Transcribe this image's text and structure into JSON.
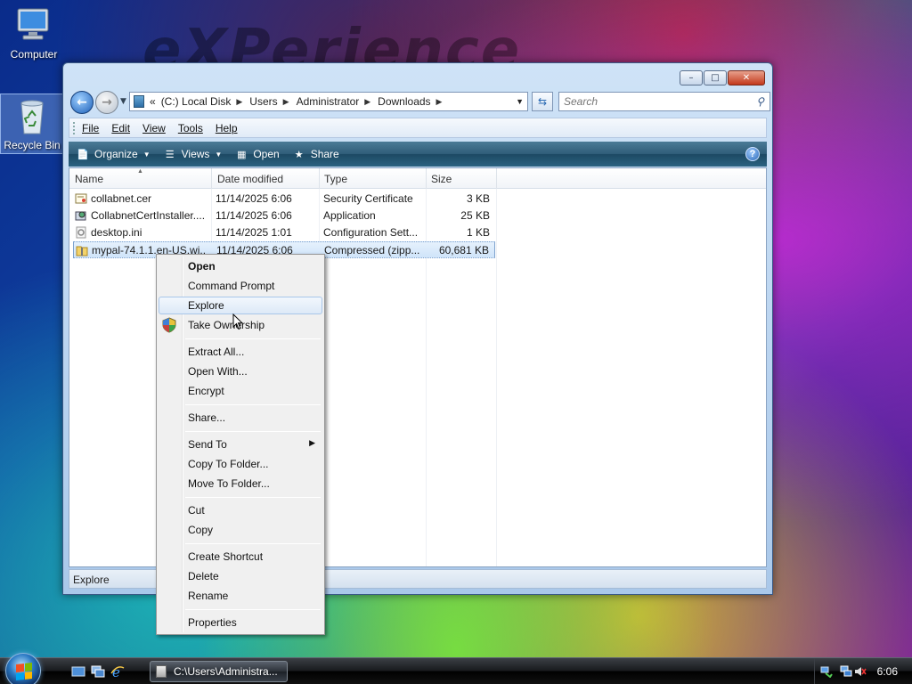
{
  "desktop": {
    "watermark": "eXPerience",
    "icons": [
      {
        "label": "Computer",
        "icon": "computer-icon"
      },
      {
        "label": "Recycle Bin",
        "icon": "recycle-bin-icon"
      }
    ]
  },
  "window": {
    "controls": {
      "minimize": "–",
      "maximize": "□",
      "close": "✕"
    },
    "address": {
      "prefix": "«",
      "crumbs": [
        "(C:) Local Disk",
        "Users",
        "Administrator",
        "Downloads"
      ],
      "separator": "▶"
    },
    "search_placeholder": "Search",
    "menu": [
      "File",
      "Edit",
      "View",
      "Tools",
      "Help"
    ],
    "toolbar": {
      "organize": "Organize",
      "views": "Views",
      "open": "Open",
      "share": "Share",
      "help": "?"
    },
    "columns": [
      "Name",
      "Date modified",
      "Type",
      "Size"
    ],
    "files": [
      {
        "name": "collabnet.cer",
        "date": "11/14/2025 6:06",
        "type": "Security Certificate",
        "size": "3 KB",
        "icon": "certificate-icon"
      },
      {
        "name": "CollabnetCertInstaller....",
        "date": "11/14/2025 6:06",
        "type": "Application",
        "size": "25 KB",
        "icon": "application-icon"
      },
      {
        "name": "desktop.ini",
        "date": "11/14/2025 1:01",
        "type": "Configuration Sett...",
        "size": "1 KB",
        "icon": "config-file-icon"
      },
      {
        "name": "mypal-74.1.1.en-US.wi...",
        "date": "11/14/2025 6:06",
        "type": "Compressed (zipp...",
        "size": "60,681 KB",
        "icon": "zip-folder-icon",
        "selected": true
      }
    ],
    "status": "Explore"
  },
  "context_menu": {
    "items": [
      {
        "label": "Open",
        "bold": true
      },
      {
        "label": "Command Prompt"
      },
      {
        "label": "Explore",
        "highlighted": true
      },
      {
        "label": "Take Ownership",
        "icon": "uac-shield-icon"
      },
      {
        "sep": true
      },
      {
        "label": "Extract All..."
      },
      {
        "label": "Open With..."
      },
      {
        "label": "Encrypt"
      },
      {
        "sep": true
      },
      {
        "label": "Share..."
      },
      {
        "sep": true
      },
      {
        "label": "Send To",
        "submenu": true
      },
      {
        "label": "Copy To Folder..."
      },
      {
        "label": "Move To Folder..."
      },
      {
        "sep": true
      },
      {
        "label": "Cut"
      },
      {
        "label": "Copy"
      },
      {
        "sep": true
      },
      {
        "label": "Create Shortcut"
      },
      {
        "label": "Delete"
      },
      {
        "label": "Rename"
      },
      {
        "sep": true
      },
      {
        "label": "Properties"
      }
    ]
  },
  "taskbar": {
    "task_label": "C:\\Users\\Administra...",
    "clock": "6:06"
  }
}
